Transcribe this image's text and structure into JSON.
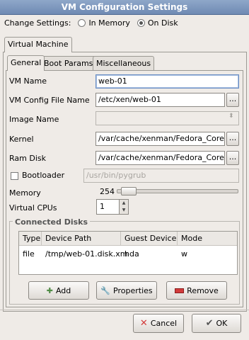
{
  "window": {
    "title": "VM Configuration Settings"
  },
  "change_settings": {
    "label": "Change Settings:",
    "options": [
      {
        "label": "In Memory",
        "selected": false
      },
      {
        "label": "On Disk",
        "selected": true
      }
    ]
  },
  "outer_tabs": [
    "Virtual Machine"
  ],
  "inner_tabs": [
    "General",
    "Boot Params",
    "Miscellaneous"
  ],
  "general": {
    "vm_name": {
      "label": "VM Name",
      "value": "web-01"
    },
    "config_file": {
      "label": "VM Config File Name",
      "value": "/etc/xen/web-01"
    },
    "image_name": {
      "label": "Image Name",
      "value": ""
    },
    "kernel": {
      "label": "Kernel",
      "value": "/var/cache/xenman/Fedora_Core_Ir"
    },
    "ram_disk": {
      "label": "Ram Disk",
      "value": "/var/cache/xenman/Fedora_Core_Ir"
    },
    "bootloader": {
      "label": "Bootloader",
      "checked": false,
      "value": "/usr/bin/pygrub"
    },
    "memory": {
      "label": "Memory",
      "value": "254",
      "slider_fraction": 0.04
    },
    "virtual_cpus": {
      "label": "Virtual CPUs",
      "value": "1"
    },
    "browse_label": "..."
  },
  "disks": {
    "title": "Connected Disks",
    "columns": [
      "Type",
      "Device Path",
      "Guest Device",
      "Mode"
    ],
    "rows": [
      {
        "type": "file",
        "path": "/tmp/web-01.disk.xm",
        "guest": "hda",
        "mode": "w"
      }
    ],
    "buttons": {
      "add": "Add",
      "properties": "Properties",
      "remove": "Remove"
    }
  },
  "dialog_buttons": {
    "cancel": "Cancel",
    "ok": "OK"
  },
  "colors": {
    "titlebar": "#7f99c1",
    "remove_icon": "#d23b3b",
    "cancel_icon": "#d23b3b",
    "add_icon": "#4f8b45"
  },
  "icons": {
    "add": "plus-icon",
    "properties": "wrench-icon",
    "remove": "minus-icon",
    "cancel": "x-icon",
    "ok": "check-icon"
  }
}
